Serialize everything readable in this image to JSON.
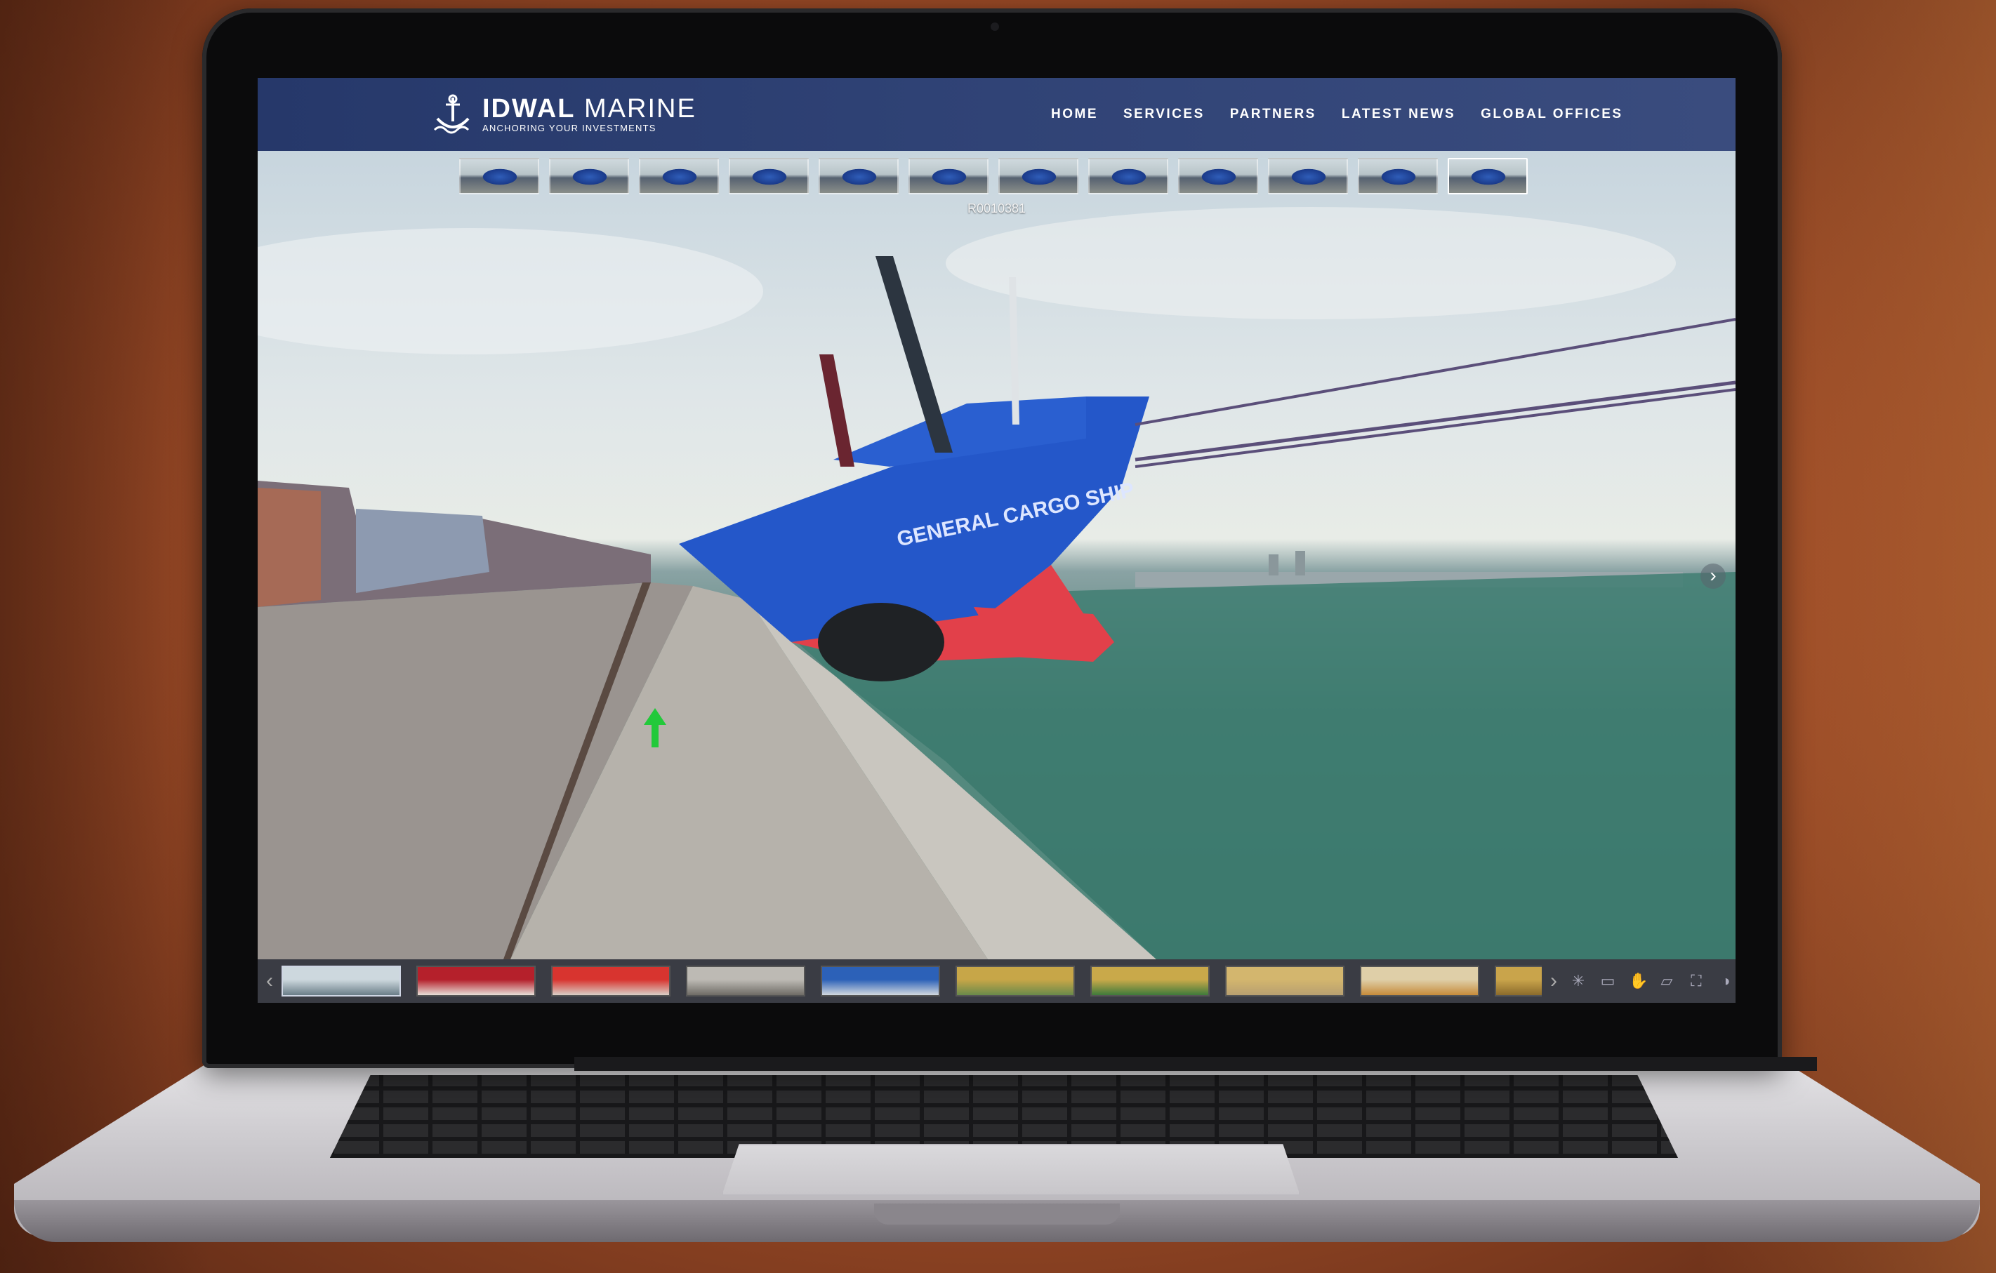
{
  "site": {
    "logo_name_bold": "IDWAL",
    "logo_name_light": "MARINE",
    "tagline": "ANCHORING YOUR INVESTMENTS"
  },
  "nav": [
    "HOME",
    "SERVICES",
    "PARTNERS",
    "LATEST NEWS",
    "GLOBAL OFFICES"
  ],
  "scene": {
    "current_label": "R0010381",
    "thumb_count": 12,
    "ship_text": "GENERAL CARGO SHIP"
  },
  "tour_strip": {
    "thumbs": [
      {
        "colors": [
          "#cdd8de",
          "#6b7e88"
        ]
      },
      {
        "colors": [
          "#b5202b",
          "#e7dfd8"
        ]
      },
      {
        "colors": [
          "#d8342f",
          "#d9cfc6"
        ]
      },
      {
        "colors": [
          "#bdbab4",
          "#6f6c66"
        ]
      },
      {
        "colors": [
          "#2c61b8",
          "#d2d8de"
        ]
      },
      {
        "colors": [
          "#c7a648",
          "#6a8a4a"
        ]
      },
      {
        "colors": [
          "#c9a94a",
          "#3f7a3b"
        ]
      },
      {
        "colors": [
          "#d3b66e",
          "#b8a070"
        ]
      },
      {
        "colors": [
          "#dfcfa8",
          "#c68b3b"
        ]
      },
      {
        "colors": [
          "#c9a44b",
          "#8b6b2c"
        ]
      }
    ]
  },
  "tools": [
    "hotspot-toggle-icon",
    "vr-icon",
    "hand-drag-icon",
    "gyro-icon",
    "fullscreen-icon",
    "info-icon"
  ],
  "colors": {
    "header": "#2f4275",
    "hull": "#2457c9",
    "hull_bottom": "#e2404a",
    "hotspot": "#22c93a"
  }
}
